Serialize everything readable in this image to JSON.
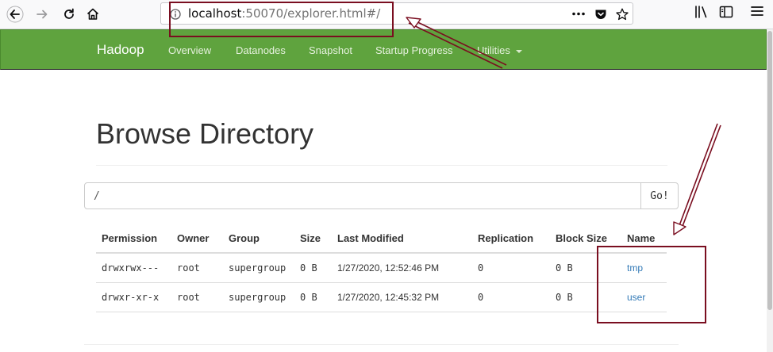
{
  "browser": {
    "url_host": "localhost",
    "url_rest": ":50070/explorer.html#/"
  },
  "navbar": {
    "brand": "Hadoop",
    "links": [
      "Overview",
      "Datanodes",
      "Snapshot",
      "Startup Progress",
      "Utilities"
    ]
  },
  "main": {
    "title": "Browse Directory",
    "path_value": "/",
    "go_label": "Go!"
  },
  "table": {
    "headers": [
      "Permission",
      "Owner",
      "Group",
      "Size",
      "Last Modified",
      "Replication",
      "Block Size",
      "Name"
    ],
    "rows": [
      [
        "drwxrwx---",
        "root",
        "supergroup",
        "0 B",
        "1/27/2020, 12:52:46 PM",
        "0",
        "0 B",
        "tmp"
      ],
      [
        "drwxr-xr-x",
        "root",
        "supergroup",
        "0 B",
        "1/27/2020, 12:45:32 PM",
        "0",
        "0 B",
        "user"
      ]
    ]
  },
  "colors": {
    "navbar": "#5fa33e",
    "annotation": "#7a0e20",
    "link": "#337ab7"
  }
}
